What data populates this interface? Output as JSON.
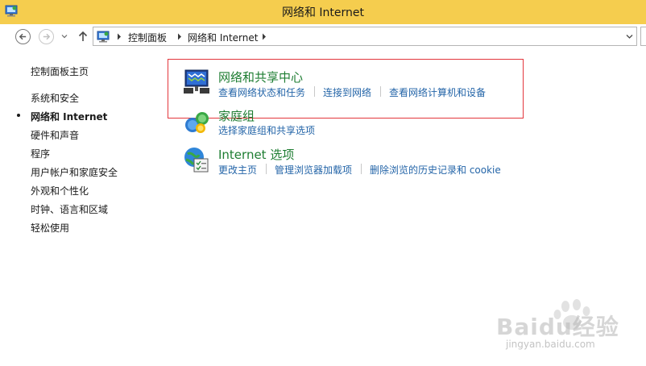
{
  "window": {
    "title": "网络和 Internet"
  },
  "address_bar": {
    "breadcrumbs": [
      "控制面板",
      "网络和 Internet"
    ]
  },
  "sidebar": {
    "home": "控制面板主页",
    "items": [
      {
        "label": "系统和安全",
        "current": false
      },
      {
        "label": "网络和 Internet",
        "current": true
      },
      {
        "label": "硬件和声音",
        "current": false
      },
      {
        "label": "程序",
        "current": false
      },
      {
        "label": "用户帐户和家庭安全",
        "current": false
      },
      {
        "label": "外观和个性化",
        "current": false
      },
      {
        "label": "时钟、语言和区域",
        "current": false
      },
      {
        "label": "轻松使用",
        "current": false
      }
    ]
  },
  "categories": [
    {
      "title": "网络和共享中心",
      "icon": "network-sharing-center-icon",
      "links": [
        "查看网络状态和任务",
        "连接到网络",
        "查看网络计算机和设备"
      ]
    },
    {
      "title": "家庭组",
      "icon": "homegroup-icon",
      "links": [
        "选择家庭组和共享选项"
      ]
    },
    {
      "title": "Internet 选项",
      "icon": "internet-options-icon",
      "links": [
        "更改主页",
        "管理浏览器加载项",
        "删除浏览的历史记录和 cookie"
      ]
    }
  ],
  "watermark": {
    "text": "Baidu经验",
    "url": "jingyan.baidu.com"
  },
  "colors": {
    "titlebar": "#f5cd4e",
    "category_title": "#1e7d32",
    "link": "#2465a8",
    "highlight_box": "#e3363c"
  }
}
